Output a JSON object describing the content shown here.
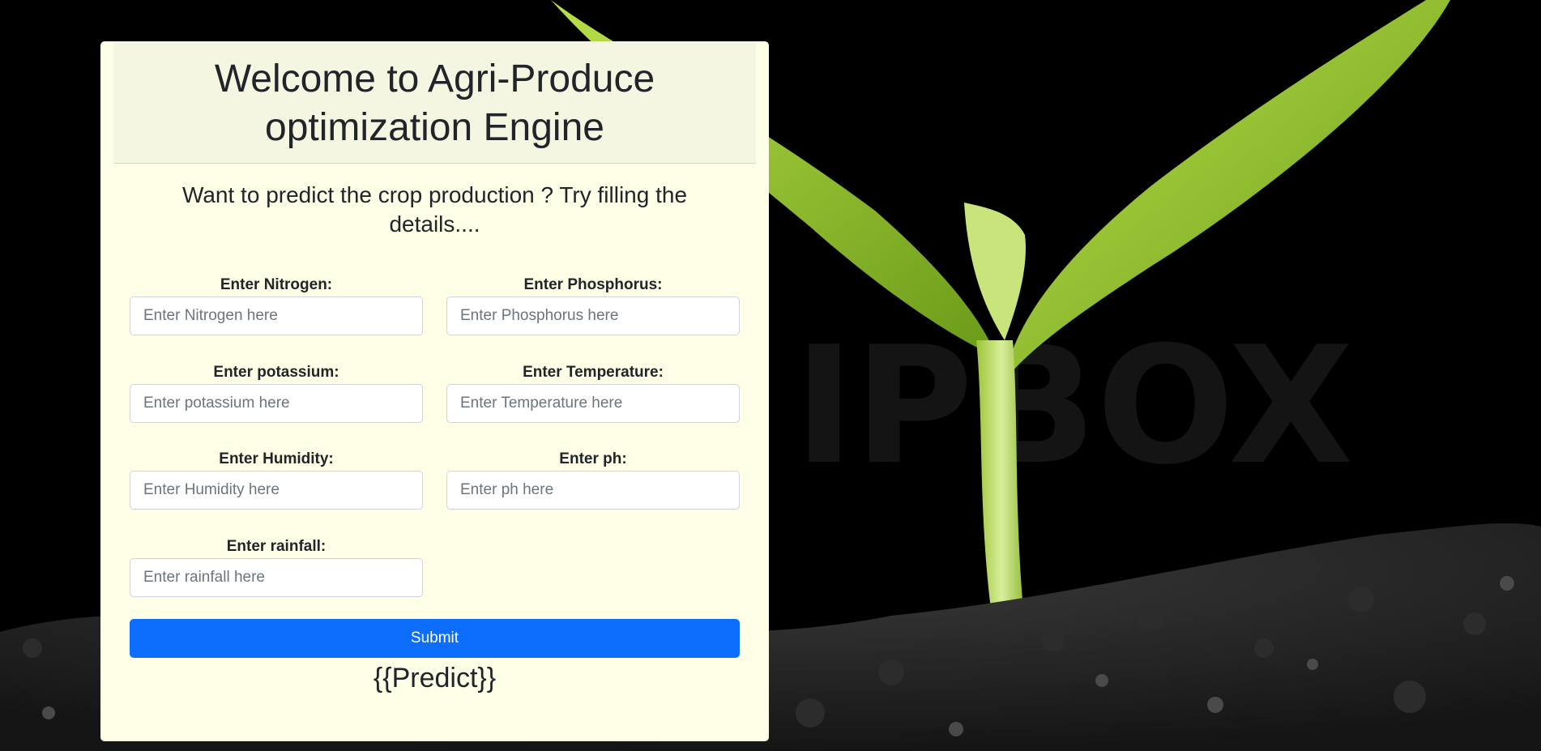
{
  "header": {
    "title_line1": "Welcome to Agri-Produce",
    "title_line2": "optimization Engine"
  },
  "subtitle": {
    "line1": "Want to predict the crop production ? Try filling the",
    "line2": "details...."
  },
  "form": {
    "fields": [
      {
        "label": "Enter Nitrogen:",
        "placeholder": "Enter Nitrogen here",
        "value": ""
      },
      {
        "label": "Enter Phosphorus:",
        "placeholder": "Enter Phosphorus here",
        "value": ""
      },
      {
        "label": "Enter potassium:",
        "placeholder": "Enter potassium here",
        "value": ""
      },
      {
        "label": "Enter Temperature:",
        "placeholder": "Enter Temperature here",
        "value": ""
      },
      {
        "label": "Enter Humidity:",
        "placeholder": "Enter Humidity here",
        "value": ""
      },
      {
        "label": "Enter ph:",
        "placeholder": "Enter ph here",
        "value": ""
      },
      {
        "label": "Enter rainfall:",
        "placeholder": "Enter rainfall here",
        "value": ""
      }
    ],
    "submit_label": "Submit",
    "prediction_text": "{{Predict}}"
  },
  "background": {
    "watermark_text": "IPBOX",
    "colors": {
      "card": "#feffe6",
      "header": "#f5f6e1",
      "button": "#0d6efd"
    }
  }
}
